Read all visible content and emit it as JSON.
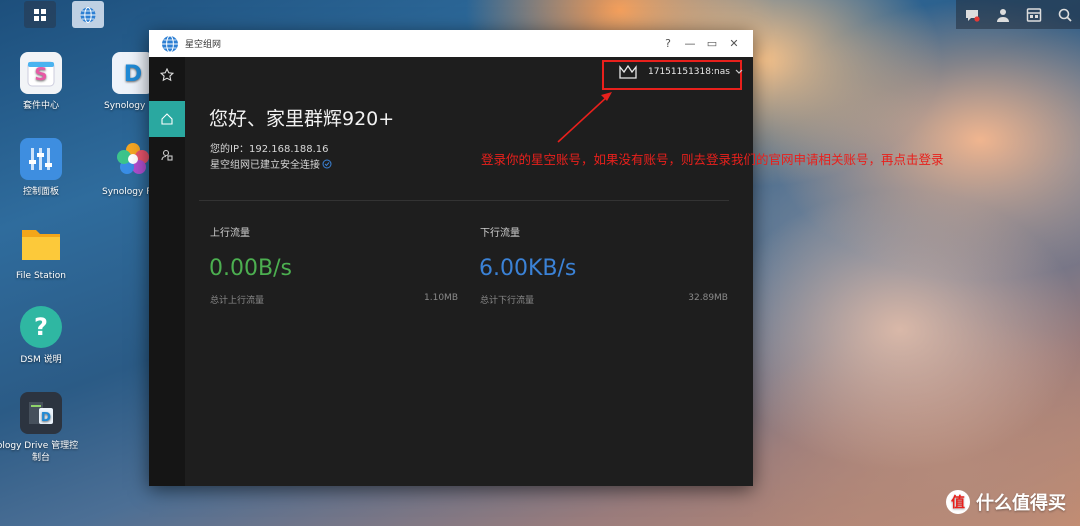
{
  "desktop": {
    "icons": [
      {
        "label": "套件中心"
      },
      {
        "label": "Synology"
      },
      {
        "label": "控制面板"
      },
      {
        "label": "Synology P"
      },
      {
        "label": "File Station"
      },
      {
        "label": "DSM 说明"
      },
      {
        "label": "ynology Drive 管理控"
      },
      {
        "label": "制台"
      }
    ]
  },
  "window": {
    "title": "星空组网",
    "controls": {
      "help": "?",
      "minimize": "—",
      "maximize": "▭",
      "close": "✕"
    }
  },
  "account": {
    "label": "17151151318:nas"
  },
  "greeting": {
    "title": "您好、家里群辉920+",
    "ip_label": "您的IP：192.168.188.16",
    "secure_text": "星空组网已建立安全连接"
  },
  "upload": {
    "label": "上行流量",
    "value": "0.00B/s",
    "total_label": "总计上行流量",
    "total_value": "1.10MB",
    "color": "#4caf50"
  },
  "download": {
    "label": "下行流量",
    "value": "6.00KB/s",
    "total_label": "总计下行流量",
    "total_value": "32.89MB",
    "color": "#3b82d6"
  },
  "annotation": {
    "text": "登录你的星空账号，如果没有账号，则去登录我们的官网申请相关账号，再点击登录",
    "color": "#e8201c"
  },
  "watermark": {
    "logo": "值",
    "text": "什么值得买"
  }
}
